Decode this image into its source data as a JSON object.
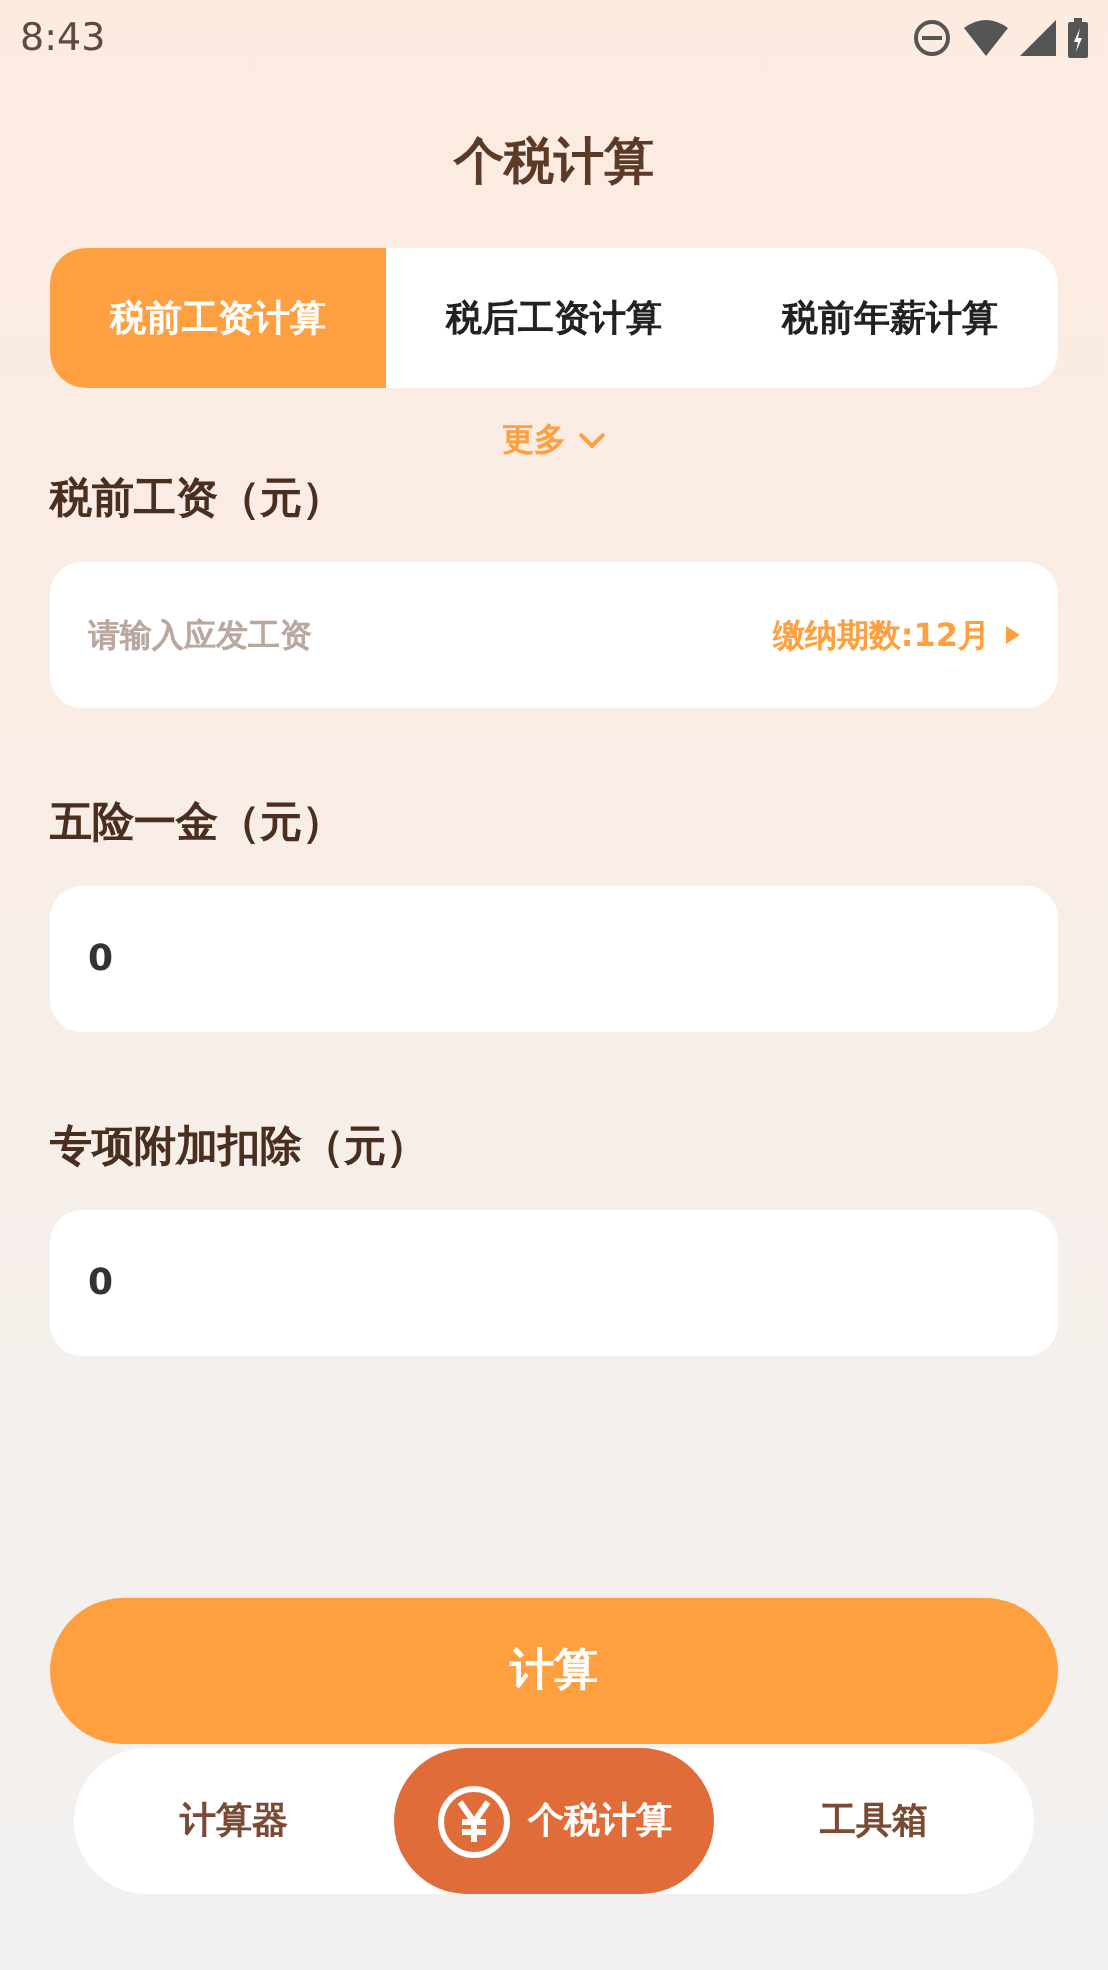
{
  "status_bar": {
    "time": "8:43"
  },
  "title": "个税计算",
  "tabs": [
    {
      "label": "税前工资计算",
      "selected": true
    },
    {
      "label": "税后工资计算",
      "selected": false
    },
    {
      "label": "税前年薪计算",
      "selected": false
    }
  ],
  "more": "更多",
  "fields": [
    {
      "label": "税前工资（元）",
      "placeholder": "请输入应发工资",
      "period": "缴纳期数:12月"
    },
    {
      "label": "五险一金（元）",
      "value": "0"
    },
    {
      "label": "专项附加扣除（元）",
      "value": "0"
    }
  ],
  "calculate_button": "计算",
  "bottom_nav": [
    {
      "label": "计算器",
      "selected": false
    },
    {
      "label": "个税计算",
      "selected": true
    },
    {
      "label": "工具箱",
      "selected": false
    }
  ]
}
